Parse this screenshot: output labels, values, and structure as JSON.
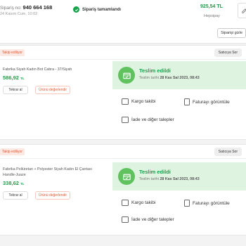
{
  "header": {
    "order_prefix": "Sipariş no:",
    "order_number": "940 664 168",
    "order_date": "24 Kasım Cum, 10:02",
    "status": "Sipariş tamamlandı",
    "total": "925,54 TL",
    "payment": "Hepsipay",
    "invoice_button": "Siparişi gizle"
  },
  "packages": [
    {
      "follow_badge": "Takip ediliyor",
      "ask_seller": "Satıcıya Sor",
      "product_name": "Fabrika Siyah Kadın Bot Cabra - 37/Siyah",
      "price": "586,92",
      "currency": "TL",
      "repurchase": "Tekrar al",
      "rate": "Ürünü değerlendir",
      "delivered_title": "Teslim edildi",
      "delivered_prefix": "Teslim tarihi",
      "delivered_date": "28 Kas Sal 2023, 08:43",
      "actions": [
        "Kargo takibi",
        "Faturayı görüntüle",
        "İade ve diğer talepler"
      ]
    },
    {
      "follow_badge": "Takip ediliyor",
      "ask_seller": "Satıcıya Sor",
      "product_name": "Fabrika Poliüretan + Polyester Siyah Kadın El Çantası Handle-Juaze",
      "price": "338,62",
      "currency": "TL",
      "repurchase": "Tekrar al",
      "rate": "Ürünü değerlendir",
      "delivered_title": "Teslim edildi",
      "delivered_prefix": "Teslim tarihi",
      "delivered_date": "28 Kas Sal 2023, 08:43",
      "actions": [
        "Kargo takibi",
        "Faturayı görüntüle",
        "İade ve diğer talepler"
      ]
    }
  ],
  "colors": {
    "accent": "#16a34a",
    "orange": "#e4572e",
    "delivery_bg": "#dff3e1"
  },
  "icons": [
    "check-icon",
    "package-icon",
    "truck-icon",
    "invoice-icon",
    "return-icon",
    "edit-icon"
  ]
}
